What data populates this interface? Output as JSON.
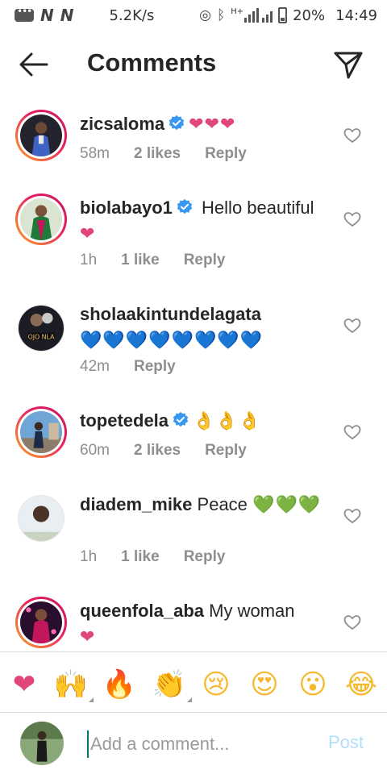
{
  "status_bar": {
    "carrier_badges": [
      "N",
      "N"
    ],
    "speed": "5.2K/s",
    "battery": "20%",
    "time": "14:49",
    "network": "H+"
  },
  "header": {
    "title": "Comments"
  },
  "comments": [
    {
      "username": "zicsaloma",
      "verified": true,
      "text": "",
      "emoji": "❤❤❤",
      "emoji_style": "pink",
      "time": "58m",
      "likes": "2 likes",
      "reply": "Reply"
    },
    {
      "username": "biolabayo1",
      "verified": true,
      "text": "Hello beautiful",
      "emoji": "❤",
      "emoji_style": "pink",
      "time": "1h",
      "likes": "1 like",
      "reply": "Reply"
    },
    {
      "username": "sholaakintundelagata",
      "verified": false,
      "text": "",
      "emoji": "💙💙💙💙💙💙💙💙",
      "emoji_style": "blue",
      "time": "42m",
      "likes": "",
      "reply": "Reply",
      "avatar_caption": "OJO NLA"
    },
    {
      "username": "topetedela",
      "verified": true,
      "text": "",
      "emoji": "👌👌👌",
      "emoji_style": "ok",
      "time": "60m",
      "likes": "2 likes",
      "reply": "Reply"
    },
    {
      "username": "diadem_mike",
      "verified": false,
      "text": "Peace",
      "emoji": "💚💚💚",
      "emoji_style": "green",
      "time": "1h",
      "likes": "1 like",
      "reply": "Reply"
    },
    {
      "username": "queenfola_aba",
      "verified": false,
      "text": "My woman",
      "emoji": "❤",
      "emoji_style": "pink",
      "time": "",
      "likes": "",
      "reply": ""
    }
  ],
  "emoji_bar": [
    "❤",
    "🙌",
    "🔥",
    "👏",
    "😢",
    "😍",
    "😮",
    "😂"
  ],
  "composer": {
    "placeholder": "Add a comment...",
    "post_label": "Post"
  },
  "colors": {
    "text": "#262626",
    "muted": "#8e8e8e",
    "verified": "#3897f0",
    "post_disabled": "#b2dffc",
    "heart_pink": "#e0457b",
    "heart_blue": "#3fb4e6",
    "heart_green": "#8cc63f"
  }
}
